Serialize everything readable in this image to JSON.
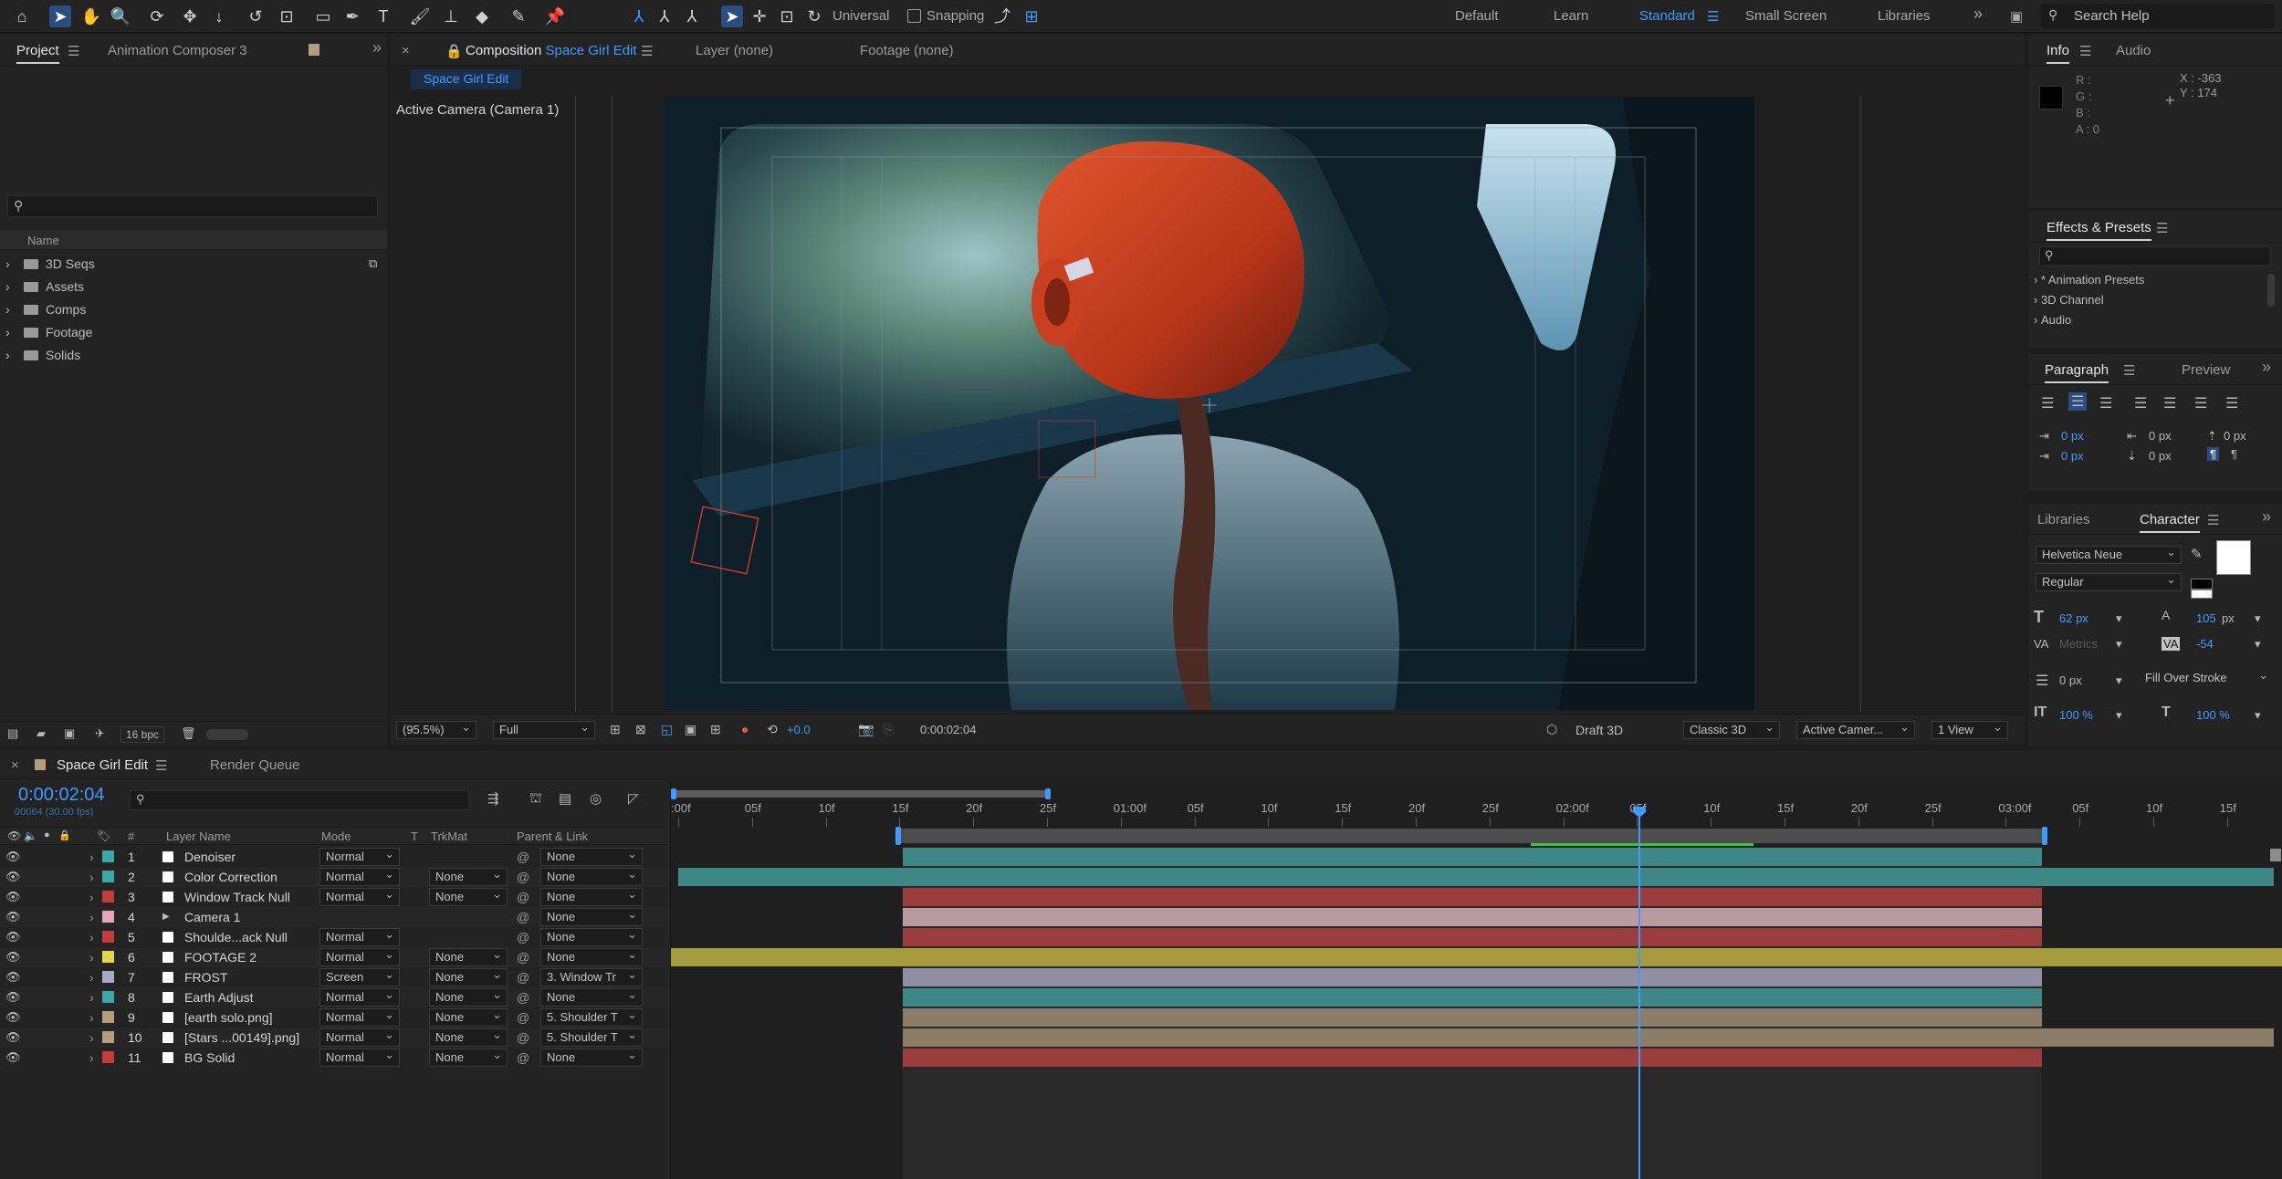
{
  "toolbar": {
    "universal_label": "Universal",
    "snapping_label": "Snapping",
    "workspaces": [
      "Default",
      "Learn",
      "Standard",
      "Small Screen",
      "Libraries"
    ],
    "active_workspace": "Standard",
    "search_placeholder": "Search Help"
  },
  "project_panel": {
    "tabs": [
      "Project",
      "Animation Composer 3"
    ],
    "column_name": "Name",
    "folders": [
      "3D Seqs",
      "Assets",
      "Comps",
      "Footage",
      "Solids"
    ],
    "bpc": "16 bpc"
  },
  "comp_panel": {
    "tab_prefix": "Composition",
    "comp_name": "Space Girl Edit",
    "layer_tab": "Layer  (none)",
    "footage_tab": "Footage  (none)",
    "breadcrumb": "Space Girl Edit",
    "active_camera": "Active Camera (Camera 1)",
    "zoom": "(95.5%)",
    "resolution": "Full",
    "exposure": "+0.0",
    "timecode": "0:00:02:04",
    "renderer_draft": "Draft 3D",
    "renderer": "Classic 3D",
    "view_camera": "Active Camer...",
    "view_layout": "1 View"
  },
  "info_panel": {
    "tabs": [
      "Info",
      "Audio"
    ],
    "r": "R :",
    "g": "G :",
    "b": "B :",
    "a": "A :  0",
    "x": "X : -363",
    "y": "Y : 174"
  },
  "effects_panel": {
    "title": "Effects & Presets",
    "items": [
      "* Animation Presets",
      "3D Channel",
      "Audio"
    ]
  },
  "paragraph_panel": {
    "tabs": [
      "Paragraph",
      "Preview"
    ],
    "values": [
      "0 px",
      "0 px",
      "0 px",
      "0 px",
      "0 px"
    ]
  },
  "character_panel": {
    "tabs": [
      "Libraries",
      "Character"
    ],
    "font": "Helvetica Neue",
    "style": "Regular",
    "size": "62 px",
    "leading": "105",
    "leading_unit": "px",
    "kerning": "Metrics",
    "tracking": "-54",
    "stroke": "0 px",
    "stroke_type": "Fill Over Stroke",
    "vscale": "100 %",
    "hscale": "100 %"
  },
  "timeline": {
    "tabs": [
      "Space Girl Edit",
      "Render Queue"
    ],
    "timecode": "0:00:02:04",
    "fps_info": "00064 (30.00 fps)",
    "columns": {
      "num": "#",
      "name": "Layer Name",
      "mode": "Mode",
      "t": "T",
      "trkmat": "TrkMat",
      "parent": "Parent & Link"
    },
    "ruler_labels": [
      ":00f",
      "05f",
      "10f",
      "15f",
      "20f",
      "25f",
      "01:00f",
      "05f",
      "10f",
      "15f",
      "20f",
      "25f",
      "02:00f",
      "05f",
      "10f",
      "15f",
      "20f",
      "25f",
      "03:00f",
      "05f",
      "10f",
      "15f"
    ],
    "layers": [
      {
        "num": "1",
        "name": "Denoiser",
        "mode": "Normal",
        "trkmat": "",
        "parent": "None",
        "color": "#3aa8a5",
        "bar_color": "#3d8787"
      },
      {
        "num": "2",
        "name": "Color Correction",
        "mode": "Normal",
        "trkmat": "None",
        "parent": "None",
        "color": "#3aa8a5",
        "bar_color": "#3d8787"
      },
      {
        "num": "3",
        "name": "Window Track Null",
        "mode": "Normal",
        "trkmat": "None",
        "parent": "None",
        "color": "#c53c3c",
        "bar_color": "#9c3d3d"
      },
      {
        "num": "4",
        "name": "Camera 1",
        "mode": "",
        "trkmat": "",
        "parent": "None",
        "color": "#e4a7b5",
        "bar_color": "#b99aa1"
      },
      {
        "num": "5",
        "name": "Shoulde...ack Null",
        "mode": "Normal",
        "trkmat": "",
        "parent": "None",
        "color": "#c53c3c",
        "bar_color": "#9c3d3d"
      },
      {
        "num": "6",
        "name": "FOOTAGE 2",
        "mode": "Normal",
        "trkmat": "None",
        "parent": "None",
        "color": "#e3d64a",
        "bar_color": "#a59b3c"
      },
      {
        "num": "7",
        "name": "FROST",
        "mode": "Screen",
        "trkmat": "None",
        "parent": "3. Window Tr",
        "color": "#a7a8c6",
        "bar_color": "#8f8fa4"
      },
      {
        "num": "8",
        "name": "Earth Adjust",
        "mode": "Normal",
        "trkmat": "None",
        "parent": "None",
        "color": "#3aa8a5",
        "bar_color": "#3d8787"
      },
      {
        "num": "9",
        "name": "[earth solo.png]",
        "mode": "Normal",
        "trkmat": "None",
        "parent": "5. Shoulder T",
        "color": "#b69d7d",
        "bar_color": "#8c7d69"
      },
      {
        "num": "10",
        "name": "[Stars ...00149].png]",
        "mode": "Normal",
        "trkmat": "None",
        "parent": "5. Shoulder T",
        "color": "#b69d7d",
        "bar_color": "#8c7d69"
      },
      {
        "num": "11",
        "name": "BG Solid",
        "mode": "Normal",
        "trkmat": "None",
        "parent": "None",
        "color": "#c53c3c",
        "bar_color": "#9c3d3d"
      }
    ]
  },
  "colors": {
    "accent": "#3f9bff",
    "panel_bg": "#232323",
    "app_bg": "#1d1d1d"
  }
}
